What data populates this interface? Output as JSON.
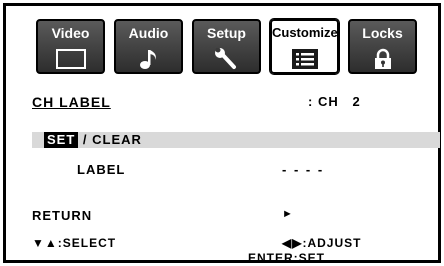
{
  "tabs": [
    {
      "label": "Video",
      "icon": "tv-icon",
      "active": false
    },
    {
      "label": "Audio",
      "icon": "music-note-icon",
      "active": false
    },
    {
      "label": "Setup",
      "icon": "wrench-icon",
      "active": false
    },
    {
      "label": "Customize",
      "icon": "list-icon",
      "active": true
    },
    {
      "label": "Locks",
      "icon": "lock-icon",
      "active": false
    }
  ],
  "ch_label": {
    "title": "CH LABEL",
    "value": ": CH   2"
  },
  "set_clear": {
    "set": "SET",
    "rest": " / CLEAR"
  },
  "label_row": {
    "label": "LABEL",
    "value": "- - - -"
  },
  "return_row": {
    "label": "RETURN",
    "arrow": "►"
  },
  "hints": {
    "select": "▼▲:SELECT",
    "adjust": "◀▶:ADJUST",
    "enter": "ENTER:SET"
  }
}
